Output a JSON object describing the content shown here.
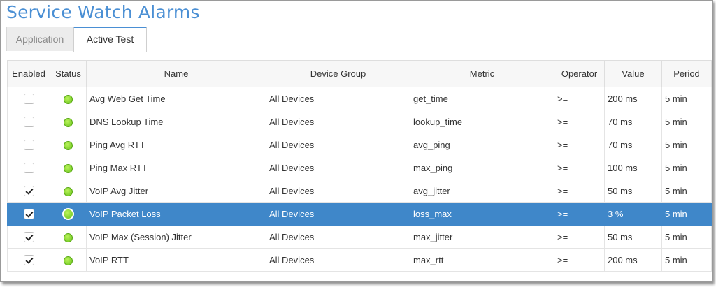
{
  "page": {
    "title": "Service Watch Alarms"
  },
  "tabs": [
    {
      "label": "Application",
      "active": false
    },
    {
      "label": "Active Test",
      "active": true
    }
  ],
  "columns": {
    "enabled": "Enabled",
    "status": "Status",
    "name": "Name",
    "device_group": "Device Group",
    "metric": "Metric",
    "operator": "Operator",
    "value": "Value",
    "period": "Period"
  },
  "status_color": "#7ed321",
  "selection_color": "#3f87c9",
  "rows": [
    {
      "enabled": false,
      "status": "ok",
      "name": "Avg Web Get Time",
      "device_group": "All Devices",
      "metric": "get_time",
      "operator": ">=",
      "value": "200 ms",
      "period": "5 min",
      "selected": false
    },
    {
      "enabled": false,
      "status": "ok",
      "name": "DNS Lookup Time",
      "device_group": "All Devices",
      "metric": "lookup_time",
      "operator": ">=",
      "value": "70 ms",
      "period": "5 min",
      "selected": false
    },
    {
      "enabled": false,
      "status": "ok",
      "name": "Ping Avg RTT",
      "device_group": "All Devices",
      "metric": "avg_ping",
      "operator": ">=",
      "value": "70 ms",
      "period": "5 min",
      "selected": false
    },
    {
      "enabled": false,
      "status": "ok",
      "name": "Ping Max RTT",
      "device_group": "All Devices",
      "metric": "max_ping",
      "operator": ">=",
      "value": "100 ms",
      "period": "5 min",
      "selected": false
    },
    {
      "enabled": true,
      "status": "ok",
      "name": "VoIP Avg Jitter",
      "device_group": "All Devices",
      "metric": "avg_jitter",
      "operator": ">=",
      "value": "50 ms",
      "period": "5 min",
      "selected": false
    },
    {
      "enabled": true,
      "status": "ok",
      "name": "VoIP Packet Loss",
      "device_group": "All Devices",
      "metric": "loss_max",
      "operator": ">=",
      "value": "3 %",
      "period": "5 min",
      "selected": true
    },
    {
      "enabled": true,
      "status": "ok",
      "name": "VoIP Max (Session) Jitter",
      "device_group": "All Devices",
      "metric": "max_jitter",
      "operator": ">=",
      "value": "50 ms",
      "period": "5 min",
      "selected": false
    },
    {
      "enabled": true,
      "status": "ok",
      "name": "VoIP RTT",
      "device_group": "All Devices",
      "metric": "max_rtt",
      "operator": ">=",
      "value": "200 ms",
      "period": "5 min",
      "selected": false
    }
  ]
}
